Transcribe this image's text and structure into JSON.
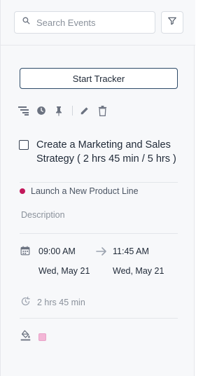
{
  "search": {
    "placeholder": "Search Events"
  },
  "actions": {
    "start_tracker_label": "Start Tracker"
  },
  "toolbar": {
    "icons": [
      "subtasks-icon",
      "clock-icon",
      "pin-icon",
      "edit-icon",
      "trash-icon"
    ]
  },
  "task": {
    "title": "Create a Marketing and Sales Strategy ( 2 hrs 45 min / 5 hrs )",
    "completed": false
  },
  "project": {
    "name": "Launch a New Product Line",
    "color": "#c2185b"
  },
  "description": {
    "placeholder": "Description"
  },
  "schedule": {
    "start_time": "09:00 AM",
    "start_date": "Wed, May 21",
    "end_time": "11:45 AM",
    "end_date": "Wed, May 21",
    "duration": "2 hrs 45 min"
  },
  "event_color": "#f3b6d6"
}
